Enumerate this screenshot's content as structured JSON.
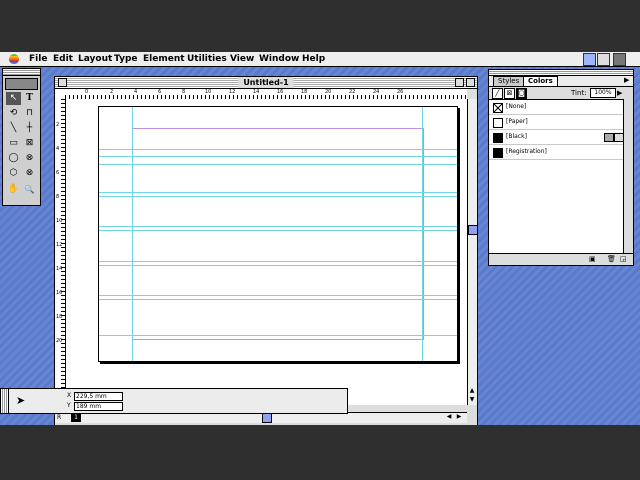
{
  "menubar": {
    "items": [
      "File",
      "Edit",
      "Layout",
      "Type",
      "Element",
      "Utilities",
      "View",
      "Window",
      "Help"
    ]
  },
  "document": {
    "title": "Untitled-1",
    "hruler_ticks": [
      "0",
      "2",
      "4",
      "6",
      "8",
      "10",
      "12",
      "14",
      "16",
      "18",
      "20",
      "22",
      "24",
      "26"
    ],
    "vruler_ticks": [
      "2",
      "4",
      "6",
      "8",
      "10",
      "12",
      "14",
      "16",
      "18",
      "20"
    ],
    "page_number": "1",
    "master_label": "R"
  },
  "toolbox": {
    "tools": [
      {
        "name": "pointer-tool",
        "glyph": "↖"
      },
      {
        "name": "text-tool",
        "glyph": "T"
      },
      {
        "name": "rotate-tool",
        "glyph": "⟲"
      },
      {
        "name": "crop-tool",
        "glyph": "⊓"
      },
      {
        "name": "line-tool",
        "glyph": "╲"
      },
      {
        "name": "constrained-line-tool",
        "glyph": "┼"
      },
      {
        "name": "rectangle-tool",
        "glyph": "▭"
      },
      {
        "name": "rectangle-frame-tool",
        "glyph": "⊠"
      },
      {
        "name": "ellipse-tool",
        "glyph": "◯"
      },
      {
        "name": "ellipse-frame-tool",
        "glyph": "⊗"
      },
      {
        "name": "polygon-tool",
        "glyph": "⬡"
      },
      {
        "name": "polygon-frame-tool",
        "glyph": "⊗"
      },
      {
        "name": "hand-tool",
        "glyph": "✋"
      },
      {
        "name": "zoom-tool",
        "glyph": "🔍"
      }
    ]
  },
  "palette": {
    "tabs": [
      "Styles",
      "Colors"
    ],
    "tint_label": "Tint:",
    "tint_value": "100%",
    "swatches": [
      {
        "label": "[None]",
        "color": "#ffffff"
      },
      {
        "label": "[Paper]",
        "color": "#ffffff"
      },
      {
        "label": "[Black]",
        "color": "#000000"
      },
      {
        "label": "[Registration]",
        "color": "#000000"
      }
    ]
  },
  "measurements": {
    "x_label": "X",
    "x_value": "229,5 mm",
    "y_label": "Y",
    "y_value": "189 mm"
  }
}
